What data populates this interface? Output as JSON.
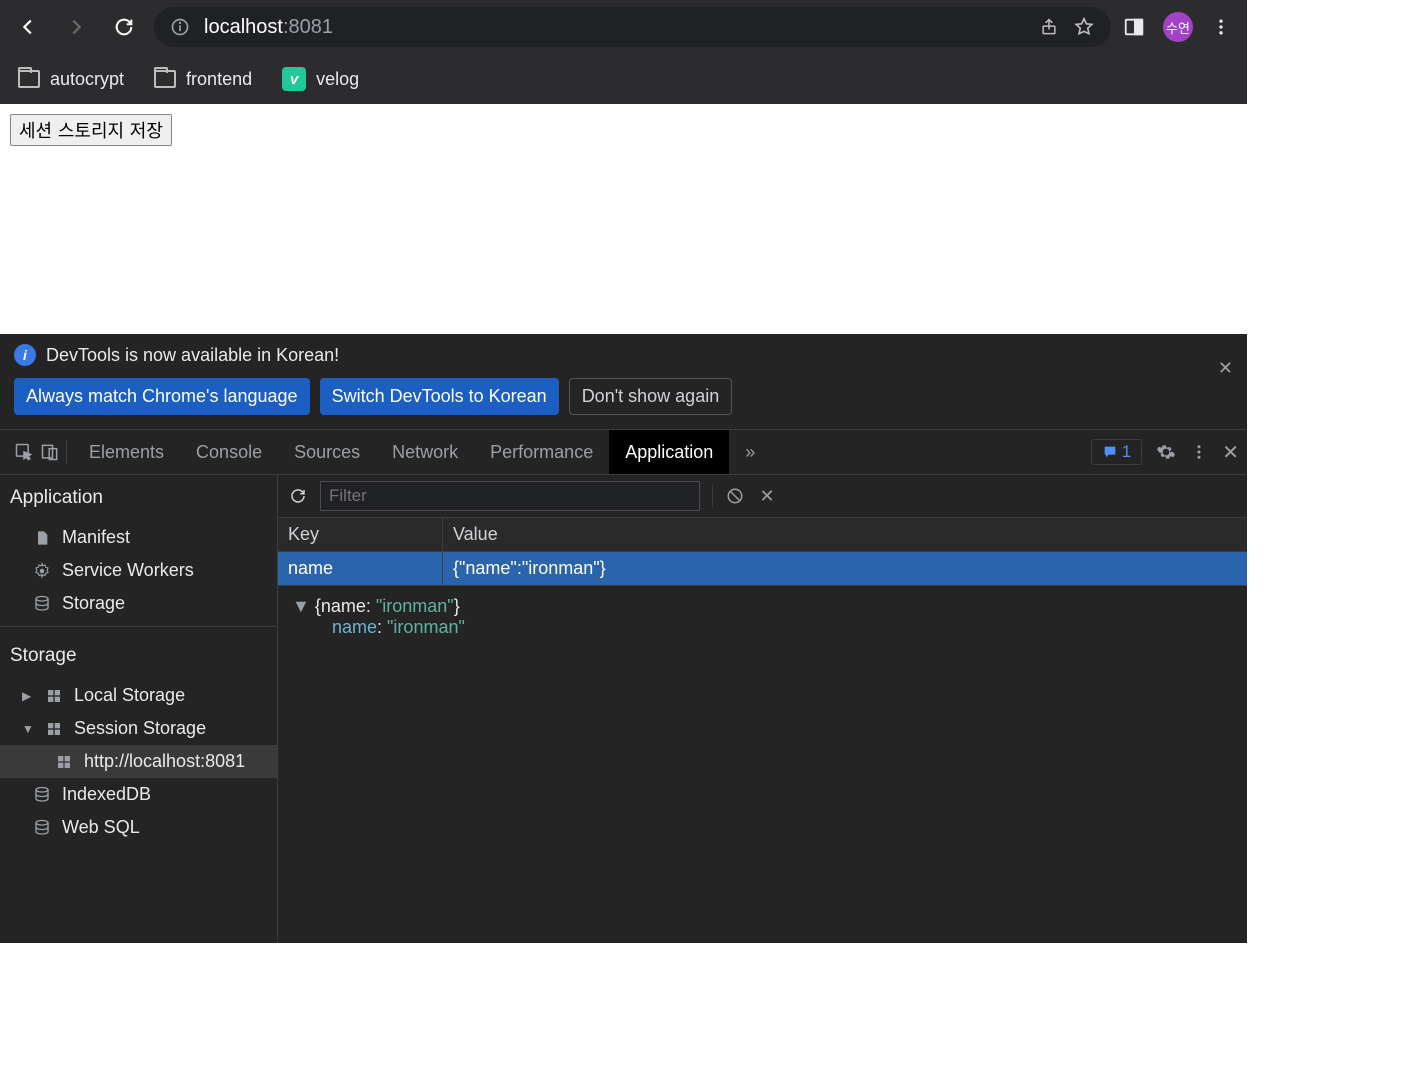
{
  "omnibox": {
    "host": "localhost",
    "port": ":8081"
  },
  "avatar_label": "수연",
  "bookmarks": [
    {
      "label": "autocrypt",
      "type": "folder"
    },
    {
      "label": "frontend",
      "type": "folder"
    },
    {
      "label": "velog",
      "type": "velog"
    }
  ],
  "page": {
    "button_label": "세션 스토리지 저장"
  },
  "devtools": {
    "banner": {
      "message": "DevTools is now available in Korean!",
      "btn_match": "Always match Chrome's language",
      "btn_switch": "Switch DevTools to Korean",
      "btn_dismiss": "Don't show again"
    },
    "tabs": [
      "Elements",
      "Console",
      "Sources",
      "Network",
      "Performance",
      "Application"
    ],
    "active_tab": "Application",
    "chat_count": "1",
    "sidebar": {
      "section_app": "Application",
      "items_app": [
        "Manifest",
        "Service Workers",
        "Storage"
      ],
      "section_storage": "Storage",
      "local": "Local Storage",
      "session": "Session Storage",
      "origin": "http://localhost:8081",
      "indexeddb": "IndexedDB",
      "websql": "Web SQL"
    },
    "filter_placeholder": "Filter",
    "table": {
      "head_key": "Key",
      "head_value": "Value",
      "row_key": "name",
      "row_value": "{\"name\":\"ironman\"}"
    },
    "viewer": {
      "line1_pre": "{name: ",
      "line1_mid": "\"ironman\"",
      "line1_post": "}",
      "line2_key": "name",
      "line2_colon": ": ",
      "line2_val": "\"ironman\""
    }
  }
}
